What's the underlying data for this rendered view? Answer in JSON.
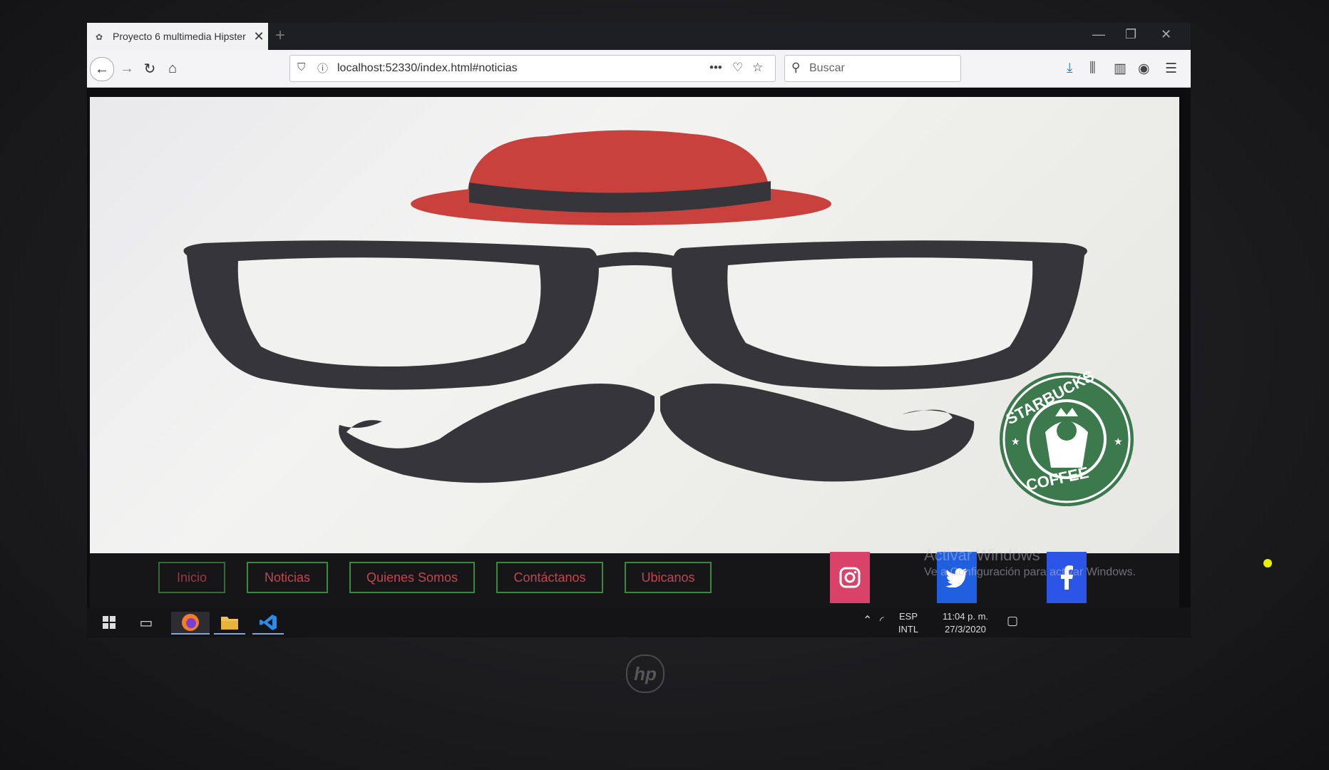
{
  "browser": {
    "tab_title": "Proyecto 6 multimedia Hipster",
    "tab_close": "✕",
    "new_tab": "+",
    "url": "localhost:52330/index.html#noticias",
    "url_more": "•••",
    "search_placeholder": "Buscar"
  },
  "page": {
    "logo_text_top": "STARBUCKS",
    "logo_text_bottom": "COFFEE",
    "nav": [
      {
        "label": "Inicio"
      },
      {
        "label": "Noticias"
      },
      {
        "label": "Quienes Somos"
      },
      {
        "label": "Contáctanos"
      },
      {
        "label": "Ubicanos"
      }
    ],
    "social": [
      "instagram-icon",
      "twitter-icon",
      "facebook-icon"
    ],
    "colors": {
      "instagram": "#d9436a",
      "twitter": "#1f5fe0",
      "facebook": "#2a55e6",
      "nav_border": "#3a8a3e",
      "nav_text": "#c2464f",
      "hat": "#c8413d",
      "glasses": "#35353a",
      "starbucks": "#3c7a4e"
    }
  },
  "watermark": {
    "title": "Activar Windows",
    "subtitle": "Ve a Configuración para activar Windows."
  },
  "taskbar": {
    "lang_top": "ESP",
    "lang_bottom": "INTL",
    "time": "11:04 p. m.",
    "date": "27/3/2020"
  },
  "laptop": {
    "brand": "hp"
  }
}
